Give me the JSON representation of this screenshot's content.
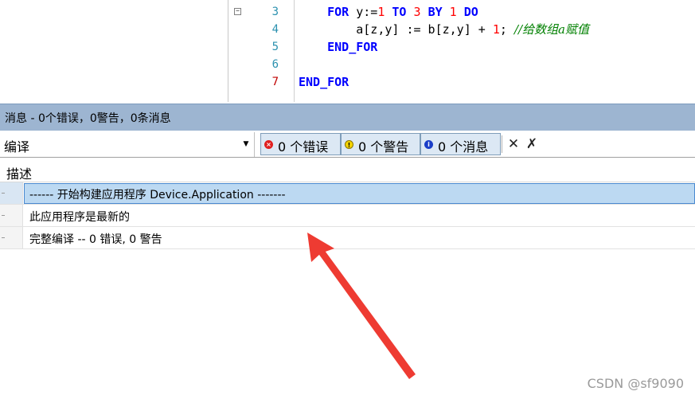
{
  "editor": {
    "fold_symbol": "⊟",
    "lines": [
      {
        "num": "3",
        "parts": [
          {
            "t": "    ",
            "c": ""
          },
          {
            "t": "FOR",
            "c": "kw"
          },
          {
            "t": " y:=",
            "c": ""
          },
          {
            "t": "1",
            "c": "num"
          },
          {
            "t": " ",
            "c": ""
          },
          {
            "t": "TO",
            "c": "kw"
          },
          {
            "t": " ",
            "c": ""
          },
          {
            "t": "3",
            "c": "num"
          },
          {
            "t": " ",
            "c": ""
          },
          {
            "t": "BY",
            "c": "kw"
          },
          {
            "t": " ",
            "c": ""
          },
          {
            "t": "1",
            "c": "num"
          },
          {
            "t": " ",
            "c": ""
          },
          {
            "t": "DO",
            "c": "kw"
          }
        ]
      },
      {
        "num": "4",
        "parts": [
          {
            "t": "        a[z,y] := b[z,y] + ",
            "c": ""
          },
          {
            "t": "1",
            "c": "num"
          },
          {
            "t": "; ",
            "c": ""
          },
          {
            "t": "//给数组a赋值",
            "c": "cm"
          }
        ]
      },
      {
        "num": "5",
        "parts": [
          {
            "t": "    ",
            "c": ""
          },
          {
            "t": "END_FOR",
            "c": "kw"
          }
        ]
      },
      {
        "num": "6",
        "parts": []
      },
      {
        "num": "7",
        "parts": [
          {
            "t": "END_FOR",
            "c": "kw"
          }
        ],
        "modified": true
      }
    ]
  },
  "messages_panel": {
    "title": "消息 - 0个错误，0警告，0条消息",
    "category_selected": "编译",
    "filters": {
      "errors": "0 个错误",
      "warnings": "0 个警告",
      "messages": "0 个消息"
    },
    "icons": {
      "error": "error-icon",
      "warning": "warning-icon",
      "info": "info-icon",
      "clear": "clear-icon",
      "clear_all": "clear-all-icon"
    },
    "column_header": "描述",
    "rows": [
      {
        "text": "------ 开始构建应用程序 Device.Application -------",
        "selected": true
      },
      {
        "text": "此应用程序是最新的",
        "selected": false
      },
      {
        "text": "完整编译 -- 0 错误, 0 警告",
        "selected": false
      }
    ]
  },
  "watermark": "CSDN @sf9090",
  "colors": {
    "title_bar": "#9db5d1",
    "selection": "#bcd9f2",
    "keyword": "#0000ff",
    "number": "#ff0000",
    "comment": "#008000",
    "arrow": "#ee3b32"
  }
}
